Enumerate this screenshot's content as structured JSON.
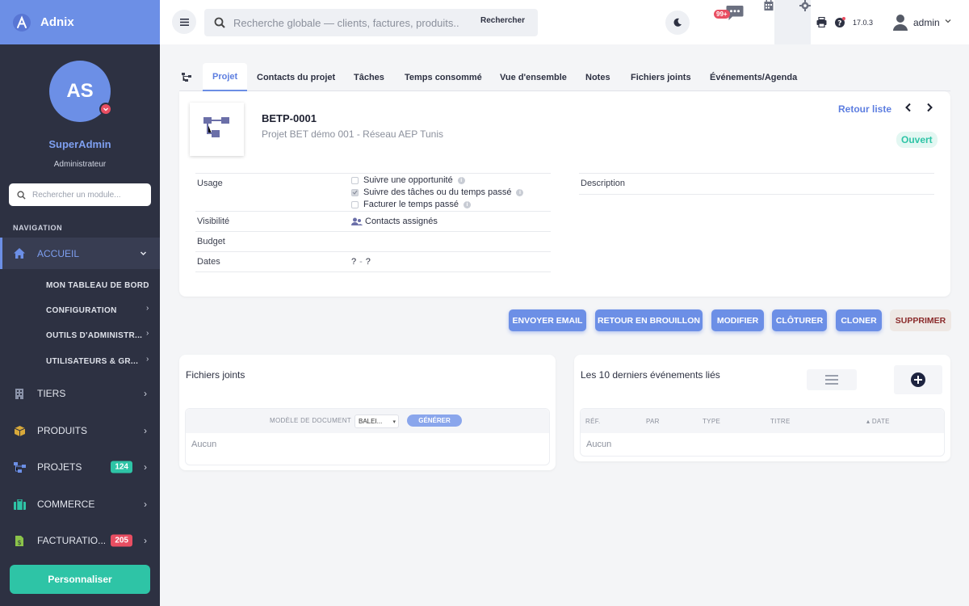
{
  "app": {
    "name": "Adnix"
  },
  "profile": {
    "initials": "AS",
    "name": "SuperAdmin",
    "role": "Administrateur"
  },
  "sidebar": {
    "search_placeholder": "Rechercher un module...",
    "nav_title": "NAVIGATION",
    "items": [
      {
        "label": "ACCUEIL",
        "icon": "home-icon"
      },
      {
        "label": "TIERS",
        "icon": "building-icon"
      },
      {
        "label": "PRODUITS",
        "icon": "box-icon"
      },
      {
        "label": "PROJETS",
        "icon": "project-tree-icon",
        "badge": "124"
      },
      {
        "label": "COMMERCE",
        "icon": "briefcase-icon"
      },
      {
        "label": "FACTURATIO...",
        "icon": "invoice-icon",
        "badge": "205"
      }
    ],
    "sub_items": [
      {
        "label": "MON TABLEAU DE BORD"
      },
      {
        "label": "CONFIGURATION"
      },
      {
        "label": "OUTILS D'ADMINISTR..."
      },
      {
        "label": "UTILISATEURS & GR..."
      }
    ],
    "personalize_label": "Personnaliser"
  },
  "topbar": {
    "search_placeholder": "Recherche globale — clients, factures, produits...",
    "search_button": "Rechercher",
    "messages_badge": "99+",
    "version": "17.0.3",
    "user": "admin"
  },
  "tabs": [
    {
      "label": "Projet",
      "active": true
    },
    {
      "label": "Contacts du projet"
    },
    {
      "label": "Tâches"
    },
    {
      "label": "Temps consommé"
    },
    {
      "label": "Vue d'ensemble"
    },
    {
      "label": "Notes"
    },
    {
      "label": "Fichiers joints"
    },
    {
      "label": "Événements/Agenda"
    }
  ],
  "project": {
    "ref": "BETP-0001",
    "label": "Projet BET démo 001 - Réseau AEP Tunis",
    "back_link": "Retour liste",
    "status": "Ouvert",
    "fields": {
      "usage_label": "Usage",
      "usage_options": [
        {
          "label": "Suivre une opportunité",
          "checked": false
        },
        {
          "label": "Suivre des tâches ou du temps passé",
          "checked": true
        },
        {
          "label": "Facturer le temps passé",
          "checked": false
        }
      ],
      "visibility_label": "Visibilité",
      "visibility_value": "Contacts assignés",
      "budget_label": "Budget",
      "dates_label": "Dates",
      "dates_start": "?",
      "dates_sep": "-",
      "dates_end": "?",
      "description_label": "Description"
    }
  },
  "actions": [
    "Envoyer email",
    "Retour en brouillon",
    "Modifier",
    "Clôturer",
    "Cloner",
    "Supprimer"
  ],
  "files_panel": {
    "title": "Fichiers joints",
    "model_label": "Modèle de document",
    "model_value": "BALEI...",
    "generate_label": "Générer",
    "empty": "Aucun"
  },
  "events_panel": {
    "title": "Les 10 derniers événements liés",
    "columns": [
      "Réf.",
      "Par",
      "Type",
      "Titre",
      "Date"
    ],
    "empty": "Aucun"
  },
  "colors": {
    "primary": "#6c8fe6",
    "sidebar": "#2d3142",
    "success": "#2ec4a6",
    "danger": "#e94e62"
  }
}
